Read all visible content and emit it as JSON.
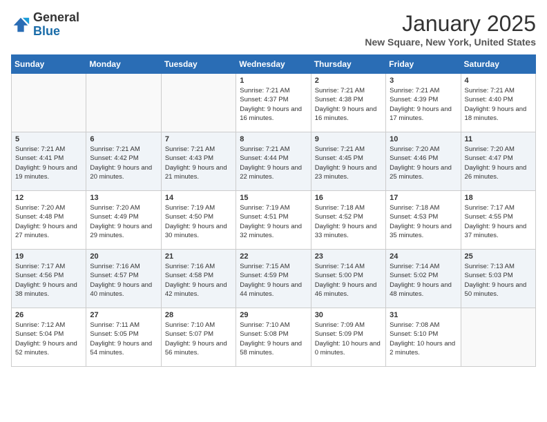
{
  "header": {
    "logo_general": "General",
    "logo_blue": "Blue",
    "month_title": "January 2025",
    "location": "New Square, New York, United States"
  },
  "days_of_week": [
    "Sunday",
    "Monday",
    "Tuesday",
    "Wednesday",
    "Thursday",
    "Friday",
    "Saturday"
  ],
  "weeks": [
    [
      {
        "day": "",
        "info": ""
      },
      {
        "day": "",
        "info": ""
      },
      {
        "day": "",
        "info": ""
      },
      {
        "day": "1",
        "info": "Sunrise: 7:21 AM\nSunset: 4:37 PM\nDaylight: 9 hours and 16 minutes."
      },
      {
        "day": "2",
        "info": "Sunrise: 7:21 AM\nSunset: 4:38 PM\nDaylight: 9 hours and 16 minutes."
      },
      {
        "day": "3",
        "info": "Sunrise: 7:21 AM\nSunset: 4:39 PM\nDaylight: 9 hours and 17 minutes."
      },
      {
        "day": "4",
        "info": "Sunrise: 7:21 AM\nSunset: 4:40 PM\nDaylight: 9 hours and 18 minutes."
      }
    ],
    [
      {
        "day": "5",
        "info": "Sunrise: 7:21 AM\nSunset: 4:41 PM\nDaylight: 9 hours and 19 minutes."
      },
      {
        "day": "6",
        "info": "Sunrise: 7:21 AM\nSunset: 4:42 PM\nDaylight: 9 hours and 20 minutes."
      },
      {
        "day": "7",
        "info": "Sunrise: 7:21 AM\nSunset: 4:43 PM\nDaylight: 9 hours and 21 minutes."
      },
      {
        "day": "8",
        "info": "Sunrise: 7:21 AM\nSunset: 4:44 PM\nDaylight: 9 hours and 22 minutes."
      },
      {
        "day": "9",
        "info": "Sunrise: 7:21 AM\nSunset: 4:45 PM\nDaylight: 9 hours and 23 minutes."
      },
      {
        "day": "10",
        "info": "Sunrise: 7:20 AM\nSunset: 4:46 PM\nDaylight: 9 hours and 25 minutes."
      },
      {
        "day": "11",
        "info": "Sunrise: 7:20 AM\nSunset: 4:47 PM\nDaylight: 9 hours and 26 minutes."
      }
    ],
    [
      {
        "day": "12",
        "info": "Sunrise: 7:20 AM\nSunset: 4:48 PM\nDaylight: 9 hours and 27 minutes."
      },
      {
        "day": "13",
        "info": "Sunrise: 7:20 AM\nSunset: 4:49 PM\nDaylight: 9 hours and 29 minutes."
      },
      {
        "day": "14",
        "info": "Sunrise: 7:19 AM\nSunset: 4:50 PM\nDaylight: 9 hours and 30 minutes."
      },
      {
        "day": "15",
        "info": "Sunrise: 7:19 AM\nSunset: 4:51 PM\nDaylight: 9 hours and 32 minutes."
      },
      {
        "day": "16",
        "info": "Sunrise: 7:18 AM\nSunset: 4:52 PM\nDaylight: 9 hours and 33 minutes."
      },
      {
        "day": "17",
        "info": "Sunrise: 7:18 AM\nSunset: 4:53 PM\nDaylight: 9 hours and 35 minutes."
      },
      {
        "day": "18",
        "info": "Sunrise: 7:17 AM\nSunset: 4:55 PM\nDaylight: 9 hours and 37 minutes."
      }
    ],
    [
      {
        "day": "19",
        "info": "Sunrise: 7:17 AM\nSunset: 4:56 PM\nDaylight: 9 hours and 38 minutes."
      },
      {
        "day": "20",
        "info": "Sunrise: 7:16 AM\nSunset: 4:57 PM\nDaylight: 9 hours and 40 minutes."
      },
      {
        "day": "21",
        "info": "Sunrise: 7:16 AM\nSunset: 4:58 PM\nDaylight: 9 hours and 42 minutes."
      },
      {
        "day": "22",
        "info": "Sunrise: 7:15 AM\nSunset: 4:59 PM\nDaylight: 9 hours and 44 minutes."
      },
      {
        "day": "23",
        "info": "Sunrise: 7:14 AM\nSunset: 5:00 PM\nDaylight: 9 hours and 46 minutes."
      },
      {
        "day": "24",
        "info": "Sunrise: 7:14 AM\nSunset: 5:02 PM\nDaylight: 9 hours and 48 minutes."
      },
      {
        "day": "25",
        "info": "Sunrise: 7:13 AM\nSunset: 5:03 PM\nDaylight: 9 hours and 50 minutes."
      }
    ],
    [
      {
        "day": "26",
        "info": "Sunrise: 7:12 AM\nSunset: 5:04 PM\nDaylight: 9 hours and 52 minutes."
      },
      {
        "day": "27",
        "info": "Sunrise: 7:11 AM\nSunset: 5:05 PM\nDaylight: 9 hours and 54 minutes."
      },
      {
        "day": "28",
        "info": "Sunrise: 7:10 AM\nSunset: 5:07 PM\nDaylight: 9 hours and 56 minutes."
      },
      {
        "day": "29",
        "info": "Sunrise: 7:10 AM\nSunset: 5:08 PM\nDaylight: 9 hours and 58 minutes."
      },
      {
        "day": "30",
        "info": "Sunrise: 7:09 AM\nSunset: 5:09 PM\nDaylight: 10 hours and 0 minutes."
      },
      {
        "day": "31",
        "info": "Sunrise: 7:08 AM\nSunset: 5:10 PM\nDaylight: 10 hours and 2 minutes."
      },
      {
        "day": "",
        "info": ""
      }
    ]
  ]
}
